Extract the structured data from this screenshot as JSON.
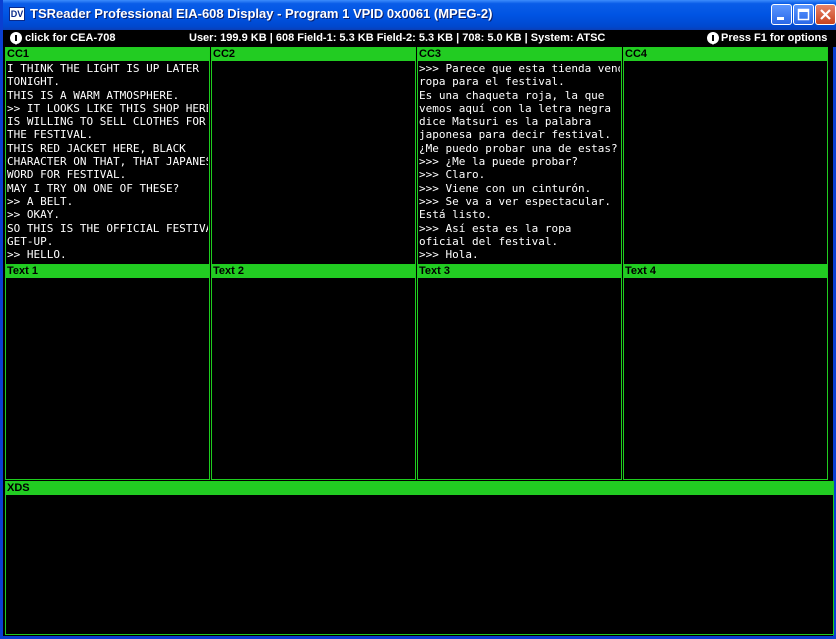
{
  "window": {
    "title": "TSReader Professional EIA-608 Display - Program 1 VPID 0x0061 (MPEG-2)",
    "icon_label": "DV"
  },
  "infobar": {
    "left": "click for CEA-708",
    "center": "User: 199.9 KB | 608 Field-1: 5.3 KB Field-2: 5.3 KB | 708: 5.0 KB | System: ATSC",
    "right": "Press F1 for options"
  },
  "panels": {
    "cc1": {
      "label": "CC1",
      "lines": [
        "I THINK THE LIGHT IS UP LATER",
        "TONIGHT.",
        "THIS IS A WARM ATMOSPHERE.",
        ">> IT LOOKS LIKE THIS SHOP HERE",
        "IS WILLING TO SELL CLOTHES FOR",
        "THE FESTIVAL.",
        "THIS RED JACKET HERE, BLACK",
        "CHARACTER ON THAT, THAT JAPANESE",
        "WORD FOR FESTIVAL.",
        "MAY I TRY ON ONE OF THESE?",
        ">> A BELT.",
        ">> OKAY.",
        "SO THIS IS THE OFFICIAL FESTIVAL",
        "GET-UP.",
        ">> HELLO."
      ]
    },
    "cc2": {
      "label": "CC2",
      "lines": []
    },
    "cc3": {
      "label": "CC3",
      "lines": [
        ">>> Parece que esta tienda vende",
        "ropa para el festival.",
        "Es una chaqueta roja, la que",
        "vemos aquí con la letra negra",
        "dice Matsuri es la palabra",
        "japonesa para decir festival.",
        "¿Me puedo probar una de estas?",
        ">>> ¿Me la puede probar?",
        ">>> Claro.",
        ">>> Viene con un cinturón.",
        ">>> Se va a ver espectacular.",
        "Está listo.",
        ">>> Así esta es la ropa",
        "oficial del festival.",
        ">>> Hola."
      ]
    },
    "cc4": {
      "label": "CC4",
      "lines": []
    },
    "text1": {
      "label": "Text 1",
      "lines": []
    },
    "text2": {
      "label": "Text 2",
      "lines": []
    },
    "text3": {
      "label": "Text 3",
      "lines": []
    },
    "text4": {
      "label": "Text 4",
      "lines": []
    },
    "xds": {
      "label": "XDS",
      "lines": []
    }
  }
}
